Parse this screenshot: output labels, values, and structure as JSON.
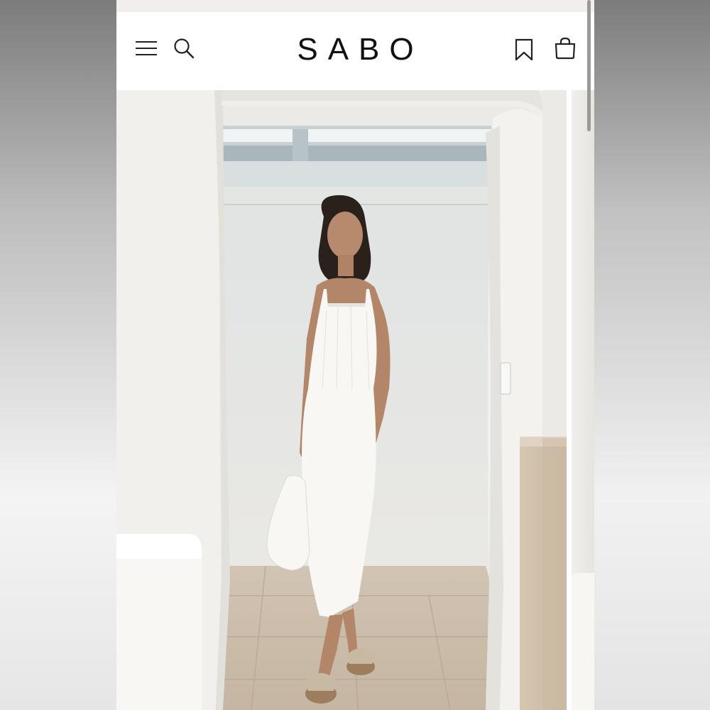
{
  "header": {
    "brand": "SABO",
    "icons": [
      "menu-icon",
      "search-icon",
      "bookmark-icon",
      "shopping-bag-icon"
    ]
  },
  "product_image": {
    "alt": "",
    "colors": {
      "wall": "#ecebe7",
      "dress": "#f7f6f2",
      "floor": "#cdbfae"
    }
  }
}
